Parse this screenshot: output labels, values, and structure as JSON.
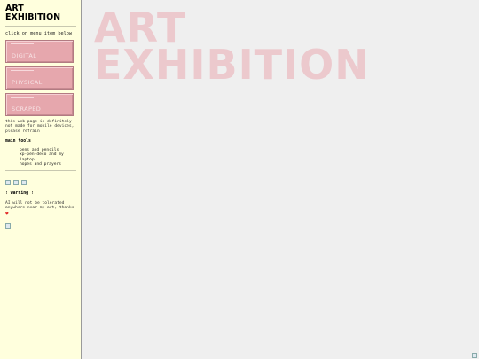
{
  "sidebar": {
    "title_line1": "ART",
    "title_line2": "EXHIBITION",
    "hint": "click on menu item below",
    "menu": [
      {
        "label": "DIGITAL"
      },
      {
        "label": "PHYSICAL"
      },
      {
        "label": "SCRAPED"
      }
    ],
    "notice": "this web page is definitely not made for mobile devices, please refrain",
    "tools_title": "main tools",
    "tools": [
      "pens and pencils",
      "xp-pen-deco and my laptop",
      "hopes and prayers"
    ],
    "warning_title": "! warning !",
    "ai_note": "AI will not be tolerated anywhere near my art, thanks",
    "heart": "❤"
  },
  "hero": {
    "line1": "ART",
    "line2": "EXHIBITION",
    "color": "#ecc9cd"
  },
  "colors": {
    "sidebar_bg": "#ffffdd",
    "button_bg": "#e6a7ad",
    "page_bg": "#efefef"
  }
}
